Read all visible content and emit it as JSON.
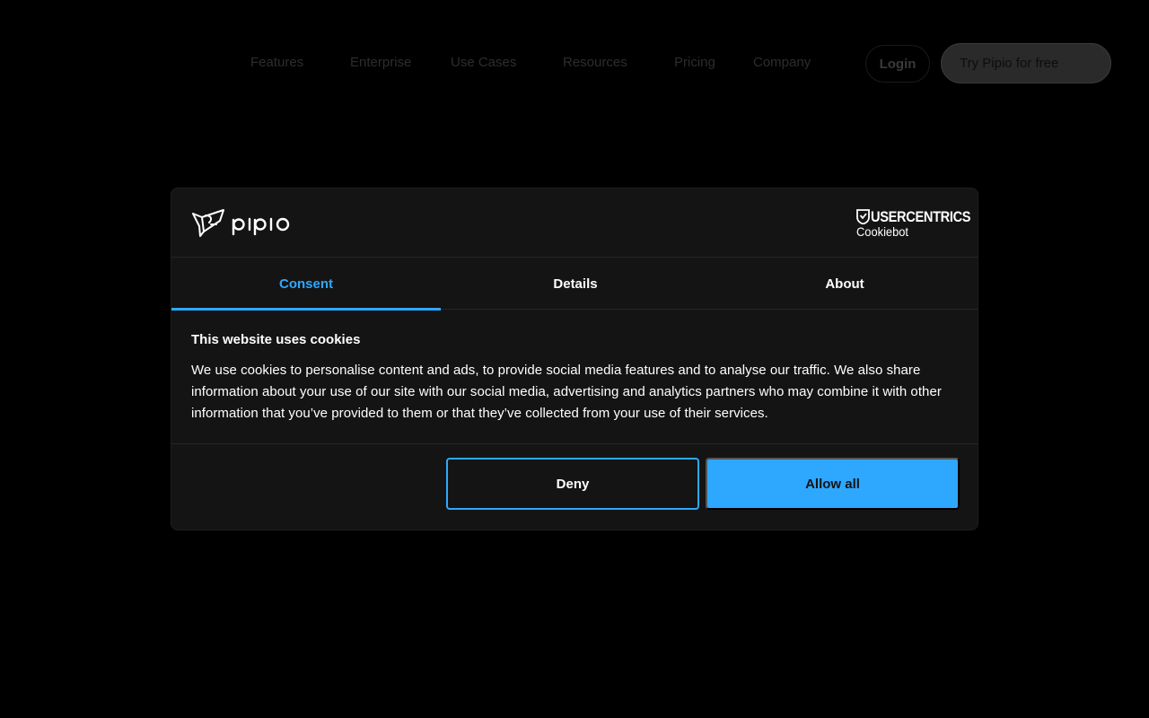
{
  "nav": {
    "links": [
      "Features",
      "Enterprise",
      "Use Cases",
      "Resources",
      "Pricing",
      "Company"
    ],
    "login": "Login",
    "cta": "Try Pipio for free"
  },
  "dialog": {
    "brand_logo": "pipio-logo",
    "provider_logo": {
      "name": "USERCENTRICS",
      "sub": "Cookiebot"
    },
    "tabs": [
      {
        "label": "Consent",
        "active": true
      },
      {
        "label": "Details",
        "active": false
      },
      {
        "label": "About",
        "active": false
      }
    ],
    "title": "This website uses cookies",
    "text": "We use cookies to personalise content and ads, to provide social media features and to analyse our traffic. We also share information about your use of our site with our social media, advertising and analytics partners who may combine it with other information that you’ve provided to them or that they’ve collected from your use of their services.",
    "deny_label": "Deny",
    "allow_label": "Allow all"
  },
  "colors": {
    "accent": "#2ea8ff",
    "dialog_bg": "#141414",
    "page_bg": "#000000"
  }
}
